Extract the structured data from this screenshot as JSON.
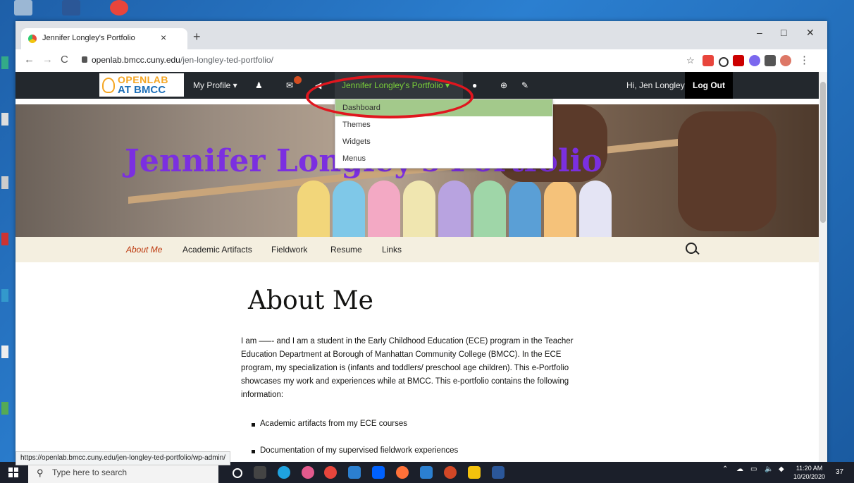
{
  "browser": {
    "tab_title": "Jennifer Longley's Portfolio",
    "tab_close": "×",
    "new_tab": "+",
    "url_host": "openlab.bmcc.cuny.edu",
    "url_path": "/jen-longley-ted-portfolio/",
    "status_url": "https://openlab.bmcc.cuny.edu/jen-longley-ted-portfolio/wp-admin/",
    "back": "←",
    "forward": "→",
    "reload": "C",
    "win_min": "–",
    "win_max": "□",
    "win_close": "✕"
  },
  "adminbar": {
    "logo_top": "OPENLAB",
    "logo_bottom": "AT BMCC",
    "my_profile": "My Profile ▾",
    "portfolio": "Jennifer Longley's Portfolio ▾",
    "greeting": "Hi, Jen Longley",
    "logout": "Log Out"
  },
  "dropdown": {
    "items": [
      "Dashboard",
      "Themes",
      "Widgets",
      "Menus"
    ]
  },
  "site": {
    "title": "Jennifer Longley's Portfolio",
    "nav": [
      "About Me",
      "Academic Artifacts",
      "Fieldwork",
      "Resume",
      "Links"
    ]
  },
  "page": {
    "heading": "About Me",
    "paragraph": "I am —–- and I am a student in the Early Childhood Education (ECE) program in the Teacher Education Department at Borough of Manhattan Community College (BMCC). In the ECE program, my specialization is  (infants and toddlers/ preschool age children). This e-Portfolio showcases my work and experiences while at BMCC. This e-portfolio contains the following information:",
    "bullets": [
      "Academic artifacts from my ECE courses",
      "Documentation of my supervised fieldwork experiences"
    ]
  },
  "taskbar": {
    "search_placeholder": "Type here to search",
    "time": "11:20 AM",
    "date": "10/20/2020",
    "notification_count": "37"
  },
  "colors": {
    "admin_bar": "#23282d",
    "portfolio_link": "#7ad03a",
    "dashboard_highlight": "#a3c98b",
    "site_title": "#7b2fe0",
    "annotation_circle": "#e0161e"
  }
}
